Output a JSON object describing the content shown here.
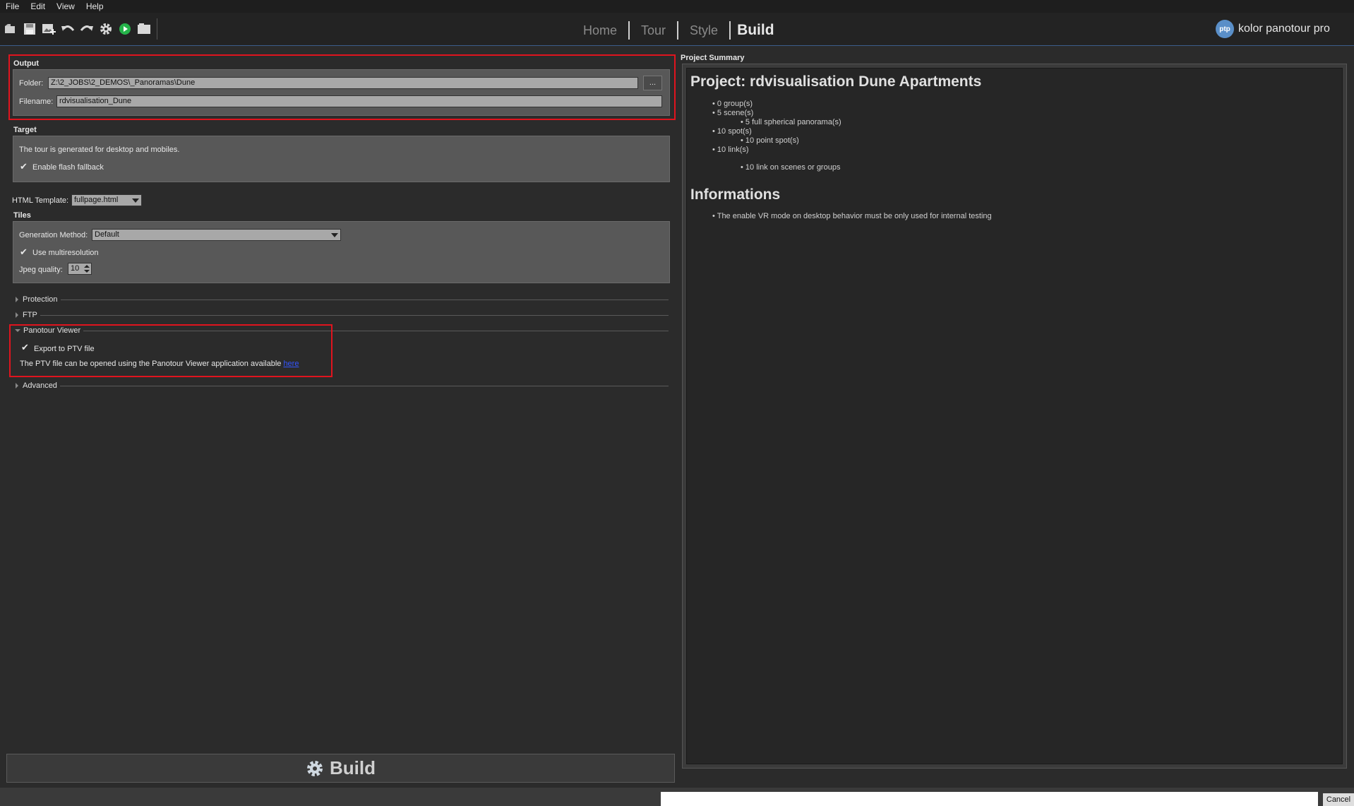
{
  "menu": [
    "File",
    "Edit",
    "View",
    "Help"
  ],
  "nav": {
    "tabs": [
      "Home",
      "Tour",
      "Style",
      "Build"
    ],
    "active": "Build"
  },
  "brand": {
    "logo_text": "ptp",
    "name": "kolor panotour pro"
  },
  "output": {
    "title": "Output",
    "folder_label": "Folder:",
    "folder_value": "Z:\\2_JOBS\\2_DEMOS\\_Panoramas\\Dune",
    "browse_label": "...",
    "filename_label": "Filename:",
    "filename_value": "rdvisualisation_Dune"
  },
  "target": {
    "title": "Target",
    "description": "The tour is generated for desktop and mobiles.",
    "flash_label": "Enable flash fallback",
    "flash_checked": true
  },
  "html_template": {
    "label": "HTML Template:",
    "value": "fullpage.html"
  },
  "tiles": {
    "title": "Tiles",
    "method_label": "Generation Method:",
    "method_value": "Default",
    "multires_label": "Use multiresolution",
    "multires_checked": true,
    "jpeg_label": "Jpeg quality:",
    "jpeg_value": "10"
  },
  "sections": {
    "protection": "Protection",
    "ftp": "FTP",
    "viewer": "Panotour Viewer",
    "advanced": "Advanced"
  },
  "viewer": {
    "export_label": "Export to PTV file",
    "export_checked": true,
    "description": "The PTV file can be opened using the Panotour Viewer application available ",
    "link_text": "here"
  },
  "build": {
    "label": "Build"
  },
  "summary": {
    "panel_title": "Project Summary",
    "project_heading": "Project: rdvisualisation Dune Apartments",
    "items": [
      "0 group(s)",
      "5 scene(s)",
      "5 full spherical panorama(s)",
      "10 spot(s)",
      "10 point spot(s)",
      "10 link(s)",
      "10 link on scenes or groups"
    ],
    "info_heading": "Informations",
    "info_items": [
      "The enable VR mode on desktop behavior must be only used for internal testing"
    ]
  },
  "status": {
    "cancel_label": "Cancel"
  }
}
